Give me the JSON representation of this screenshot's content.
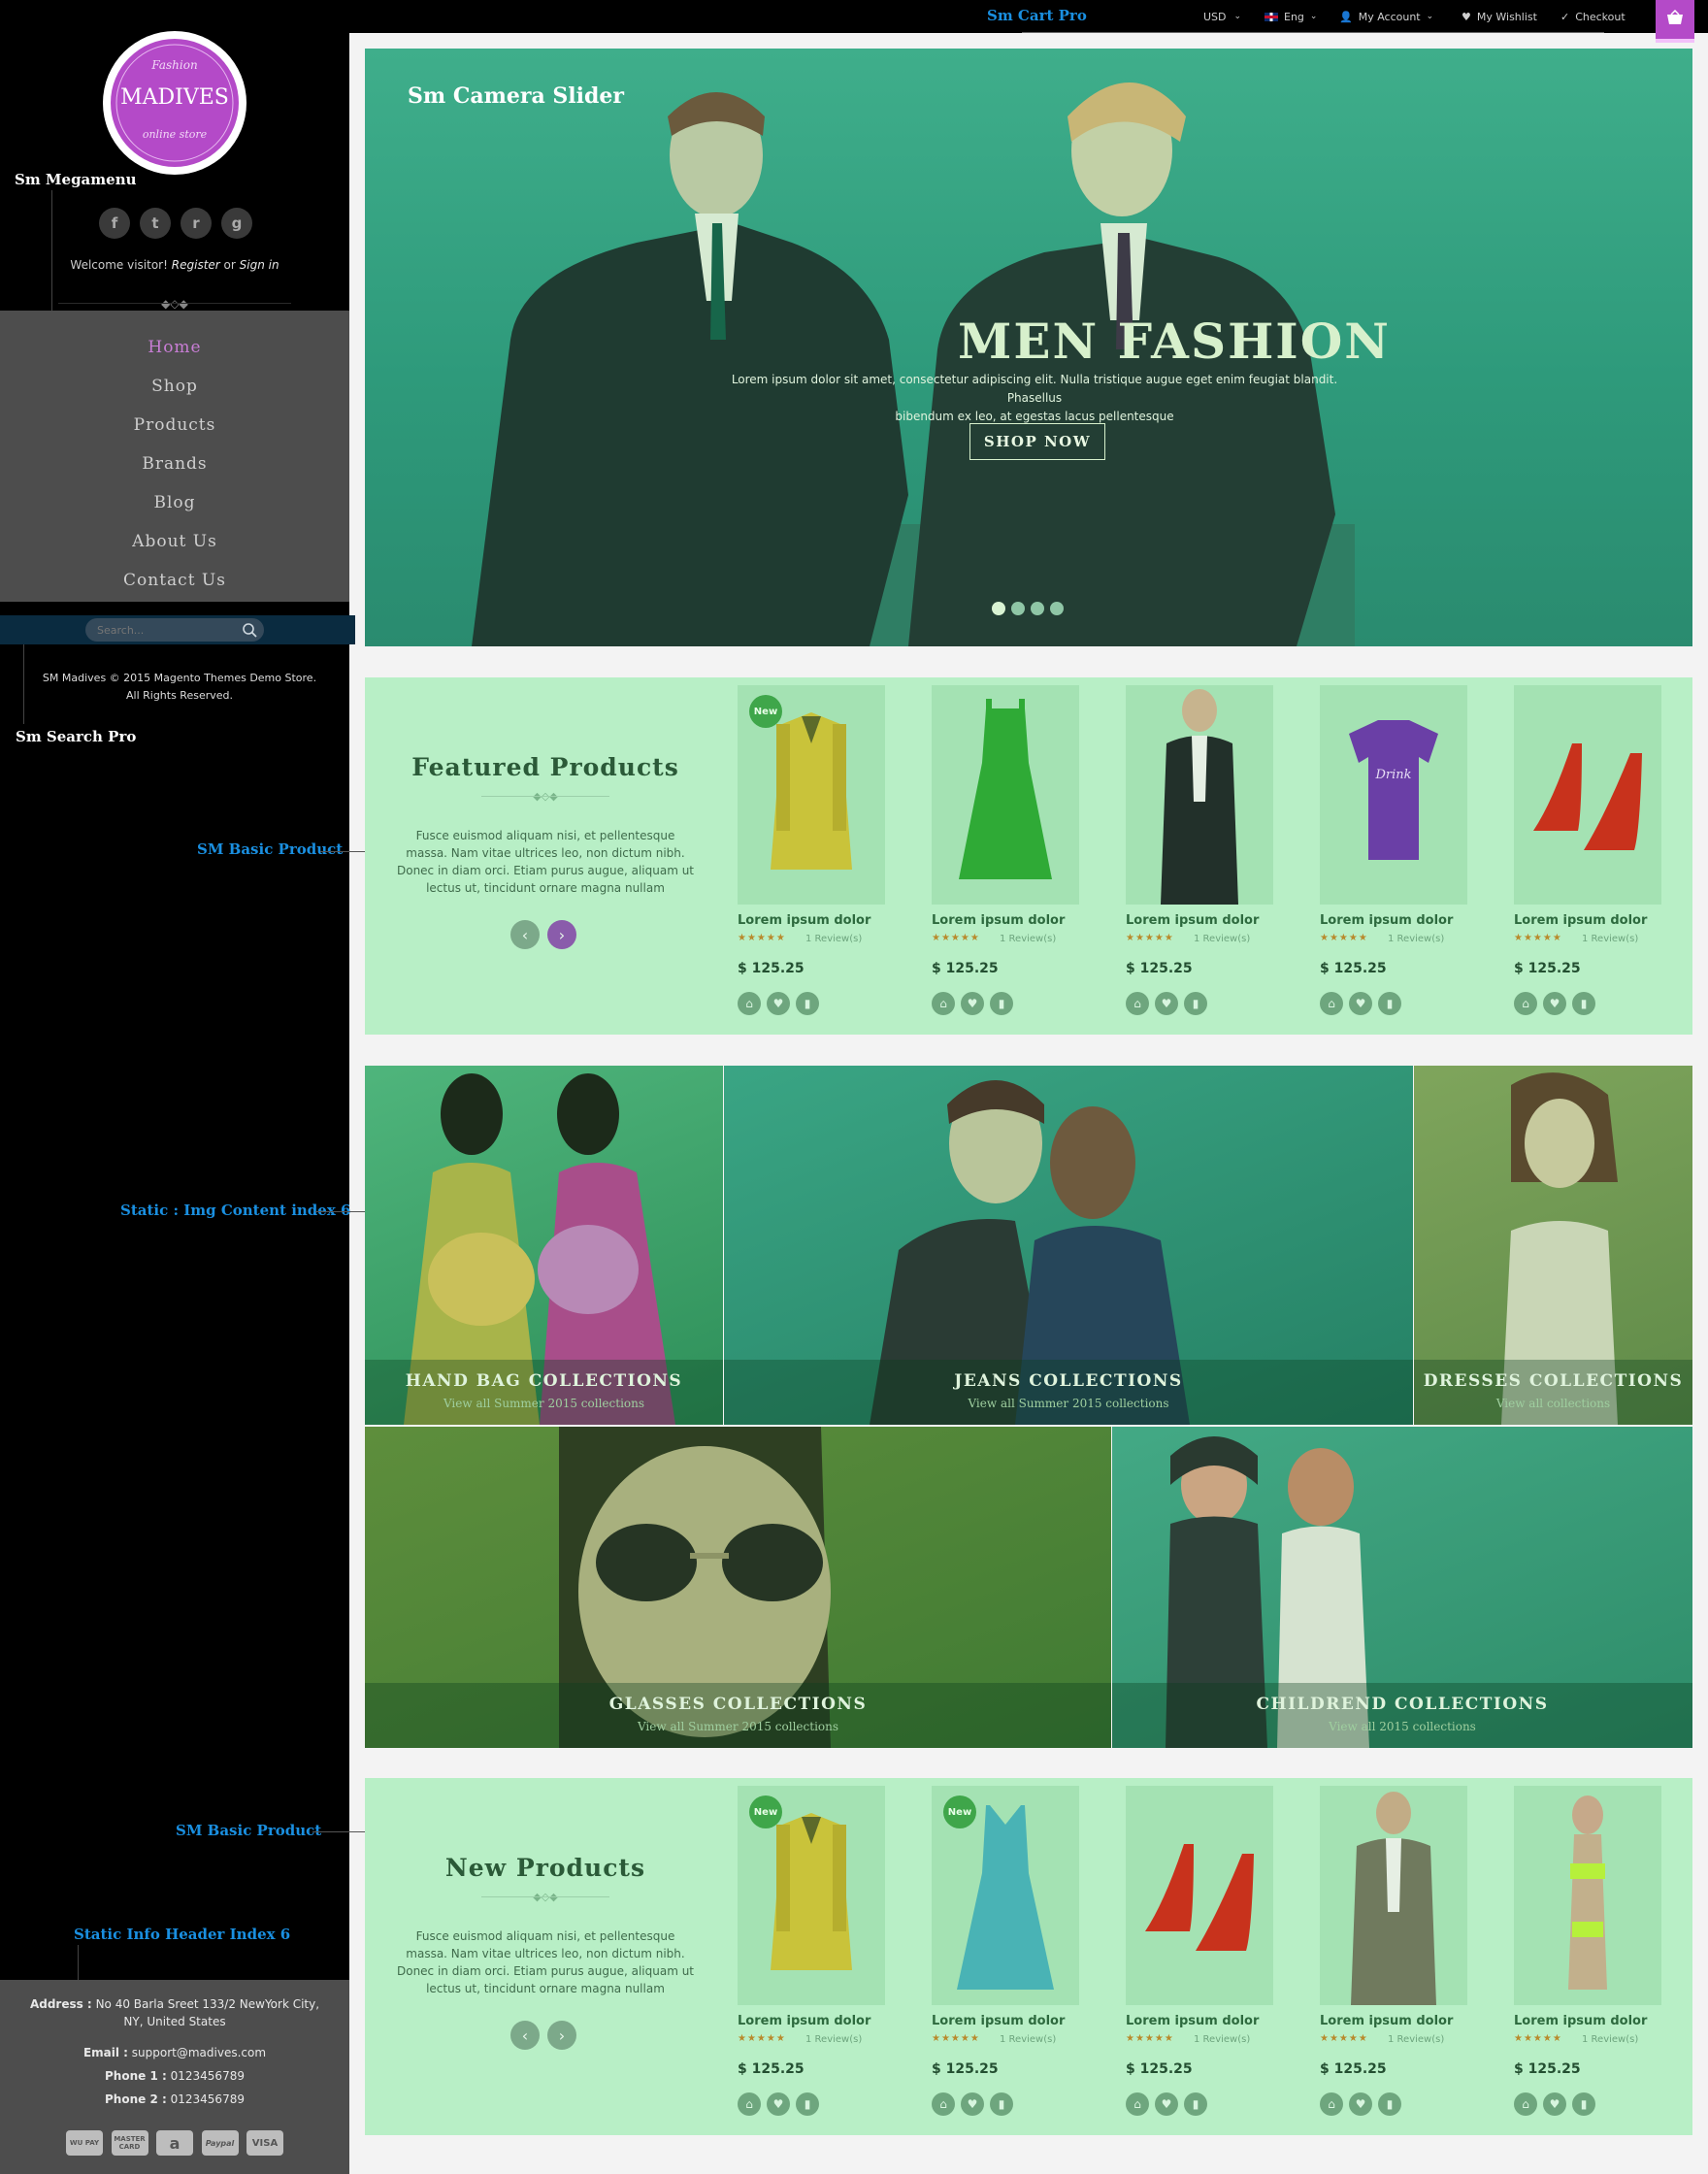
{
  "colors": {
    "accent": "#b44ac8",
    "nav_active": "#c97ed6",
    "panel_bg": "#b8efc6",
    "annotation_blue": "#1a8fe0",
    "hero_tint": "#2e9e7e"
  },
  "annotations": {
    "megamenu": "Sm Megamenu",
    "cart_pro": "Sm Cart Pro",
    "camera_slider": "Sm Camera Slider",
    "search_pro": "Sm Search Pro",
    "basic_product_1": "SM Basic Product",
    "img_content": "Static : Img Content index 6",
    "basic_product_2": "SM Basic Product",
    "info_header": "Static Info Header Index 6"
  },
  "logo": {
    "top": "Fashion",
    "name": "MADIVES",
    "bottom": "online store"
  },
  "social_icons": [
    "facebook-icon",
    "twitter-icon",
    "rss-icon",
    "google-plus-icon"
  ],
  "social_glyphs": [
    "f",
    "t",
    "r",
    "g"
  ],
  "welcome": {
    "text": "Welcome visitor!",
    "register": "Register",
    "or": "or",
    "signin": "Sign in"
  },
  "nav": [
    {
      "label": "Home",
      "active": true
    },
    {
      "label": "Shop"
    },
    {
      "label": "Products"
    },
    {
      "label": "Brands"
    },
    {
      "label": "Blog"
    },
    {
      "label": "About Us"
    },
    {
      "label": "Contact Us"
    }
  ],
  "search": {
    "placeholder": "Search..."
  },
  "copyright": {
    "line1": "SM Madives © 2015 Magento Themes Demo Store.",
    "line2": "All Rights Reserved."
  },
  "topbar": {
    "currency": "USD",
    "language": "Eng",
    "account": "My Account",
    "wishlist": "My Wishlist",
    "checkout": "Checkout"
  },
  "hero": {
    "title": "MEN FASHION",
    "text1": "Lorem ipsum dolor sit amet, consectetur adipiscing elit. Nulla tristique augue eget enim feugiat blandit. Phasellus",
    "text2": "bibendum ex leo, at egestas lacus pellentesque",
    "button": "SHOP NOW",
    "dots": 4,
    "active_dot": 0
  },
  "featured": {
    "title": "Featured Products",
    "desc": "Fusce euismod aliquam nisi, et pellentesque massa. Nam vitae ultrices leo, non dictum nibh. Donec in diam orci. Etiam purus augue, aliquam ut lectus ut, tincidunt ornare magna nullam",
    "products": [
      {
        "name": "Lorem ipsum dolor",
        "reviews": "1 Review(s)",
        "price": "$ 125.25",
        "badge": "New",
        "kind": "yellow-coat"
      },
      {
        "name": "Lorem ipsum dolor",
        "reviews": "1 Review(s)",
        "price": "$ 125.25",
        "badge": "",
        "kind": "green-dress"
      },
      {
        "name": "Lorem ipsum dolor",
        "reviews": "1 Review(s)",
        "price": "$ 125.25",
        "badge": "",
        "kind": "tuxedo"
      },
      {
        "name": "Lorem ipsum dolor",
        "reviews": "1 Review(s)",
        "price": "$ 125.25",
        "badge": "",
        "kind": "purple-tshirt"
      },
      {
        "name": "Lorem ipsum dolor",
        "reviews": "1 Review(s)",
        "price": "$ 125.25",
        "badge": "",
        "kind": "red-heels"
      }
    ]
  },
  "collections": [
    {
      "title": "HAND BAG COLLECTIONS",
      "sub": "View all Summer 2015 collections"
    },
    {
      "title": "JEANS COLLECTIONS",
      "sub": "View all Summer 2015 collections"
    },
    {
      "title": "DRESSES COLLECTIONS",
      "sub": "View all collections"
    },
    {
      "title": "GLASSES COLLECTIONS",
      "sub": "View all Summer 2015 collections"
    },
    {
      "title": "CHILDREND COLLECTIONS",
      "sub": "View all 2015 collections"
    }
  ],
  "newp": {
    "title": "New Products",
    "desc": "Fusce euismod aliquam nisi, et pellentesque massa. Nam vitae ultrices leo, non dictum nibh. Donec in diam orci. Etiam purus augue, aliquam ut lectus ut, tincidunt ornare magna nullam",
    "products": [
      {
        "name": "Lorem ipsum dolor",
        "reviews": "1 Review(s)",
        "price": "$ 125.25",
        "badge": "New",
        "kind": "yellow-coat"
      },
      {
        "name": "Lorem ipsum dolor",
        "reviews": "1 Review(s)",
        "price": "$ 125.25",
        "badge": "New",
        "kind": "blue-dress"
      },
      {
        "name": "Lorem ipsum dolor",
        "reviews": "1 Review(s)",
        "price": "$ 125.25",
        "badge": "",
        "kind": "red-heels"
      },
      {
        "name": "Lorem ipsum dolor",
        "reviews": "1 Review(s)",
        "price": "$ 125.25",
        "badge": "",
        "kind": "grey-suit"
      },
      {
        "name": "Lorem ipsum dolor",
        "reviews": "1 Review(s)",
        "price": "$ 125.25",
        "badge": "",
        "kind": "lingerie"
      }
    ]
  },
  "stars": "★★★★★",
  "prev_glyph": "‹",
  "next_glyph": "›",
  "footer": {
    "address_label": "Address :",
    "address": "No 40 Barla Sreet 133/2 NewYork City,",
    "address2": "NY,  United States",
    "email_label": "Email :",
    "email": "support@madives.com",
    "phone1_label": "Phone 1 :",
    "phone1": "0123456789",
    "phone2_label": "Phone 2 :",
    "phone2": "0123456789"
  },
  "payments": [
    "WU PAY",
    "MASTER CARD",
    "a",
    "Paypal",
    "VISA"
  ]
}
